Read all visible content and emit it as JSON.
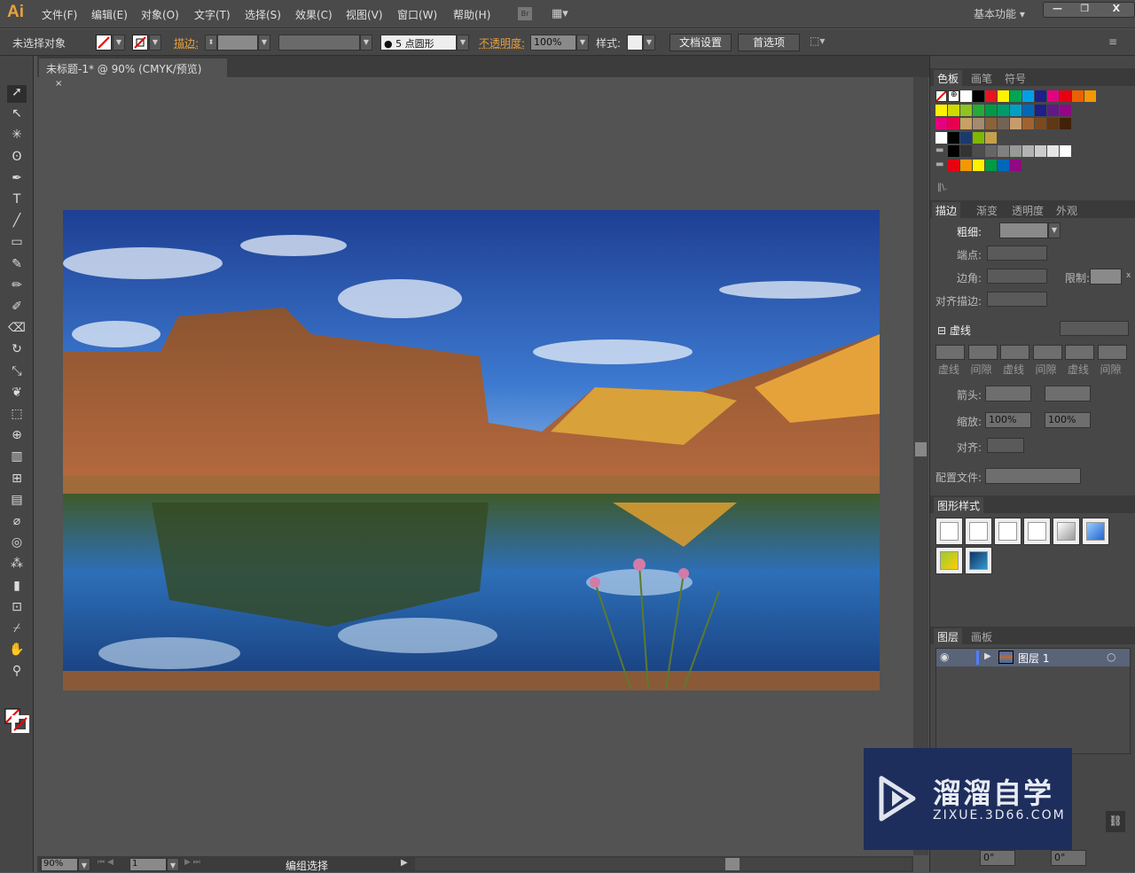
{
  "app": {
    "logo": "Ai",
    "workspace": "基本功能 ▾"
  },
  "menu": [
    "文件(F)",
    "编辑(E)",
    "对象(O)",
    "文字(T)",
    "选择(S)",
    "效果(C)",
    "视图(V)",
    "窗口(W)",
    "帮助(H)"
  ],
  "bridge": "Br",
  "window_controls": {
    "minimize": "—",
    "restore": "❐",
    "close": "X"
  },
  "control": {
    "selection": "未选择对象",
    "stroke_label": "描边:",
    "brush": "● 5 点圆形",
    "opacity_label": "不透明度:",
    "opacity": "100%",
    "style_label": "样式:",
    "doc_setup": "文档设置",
    "prefs": "首选项"
  },
  "document": {
    "tab": "未标题-1* @ 90% (CMYK/预览)",
    "close": "×"
  },
  "status": {
    "zoom": "90%",
    "artboard": "1",
    "tool": "编组选择"
  },
  "swatches": {
    "tabs": [
      "色板",
      "画笔",
      "符号"
    ],
    "rows": [
      [
        "#ffffff",
        "#000000",
        "#e8141c",
        "#fff100",
        "#00a650",
        "#00a0e9",
        "#1d2088",
        "#e4007f",
        "#e60012",
        "#eb6100",
        "#f39800"
      ],
      [
        "#fff100",
        "#cfdb00",
        "#8fc31f",
        "#22ac38",
        "#009944",
        "#009b6b",
        "#00a0c1",
        "#0068b7",
        "#1d2088",
        "#601986",
        "#920783"
      ],
      [
        "#e4007f",
        "#e5004f",
        "#c8a063",
        "#a68a6d",
        "#8c6239",
        "#736357",
        "#c69c6d",
        "#a0632f",
        "#7d4a1e",
        "#603813",
        "#42210b"
      ],
      [
        "#ffffff",
        "#000000",
        "#1a3a6e",
        "#7fb800",
        "#c4a04a"
      ],
      [
        "#000000",
        "#333333",
        "#4d4d4d",
        "#666666",
        "#808080",
        "#999999",
        "#b3b3b3",
        "#cccccc",
        "#e6e6e6",
        "#ffffff"
      ],
      [
        "#e60012",
        "#f39800",
        "#fff100",
        "#009944",
        "#0068b7",
        "#920783"
      ]
    ]
  },
  "stroke": {
    "tabs": [
      "描边",
      "渐变",
      "透明度",
      "外观"
    ],
    "weight": "粗细:",
    "cap": "端点:",
    "corner": "边角:",
    "limit": "限制:",
    "limit_unit": "x",
    "align": "对齐描边:",
    "dash_title": "虚线",
    "dash_labels": [
      "虚线",
      "间隙",
      "虚线",
      "间隙",
      "虚线",
      "间隙"
    ],
    "arrow": "箭头:",
    "scale": "缩放:",
    "scale1": "100%",
    "scale2": "100%",
    "arrow_align": "对齐:",
    "profile": "配置文件:"
  },
  "graphic_styles": {
    "title": "图形样式"
  },
  "layers": {
    "tabs": [
      "图层",
      "画板"
    ],
    "items": [
      {
        "name": "图层 1",
        "color": "#4f7fff"
      }
    ]
  },
  "transform": {
    "angle1": "0°",
    "angle2": "0°"
  },
  "watermark": {
    "title": "溜溜自学",
    "url": "ZIXUE.3D66.COM"
  }
}
